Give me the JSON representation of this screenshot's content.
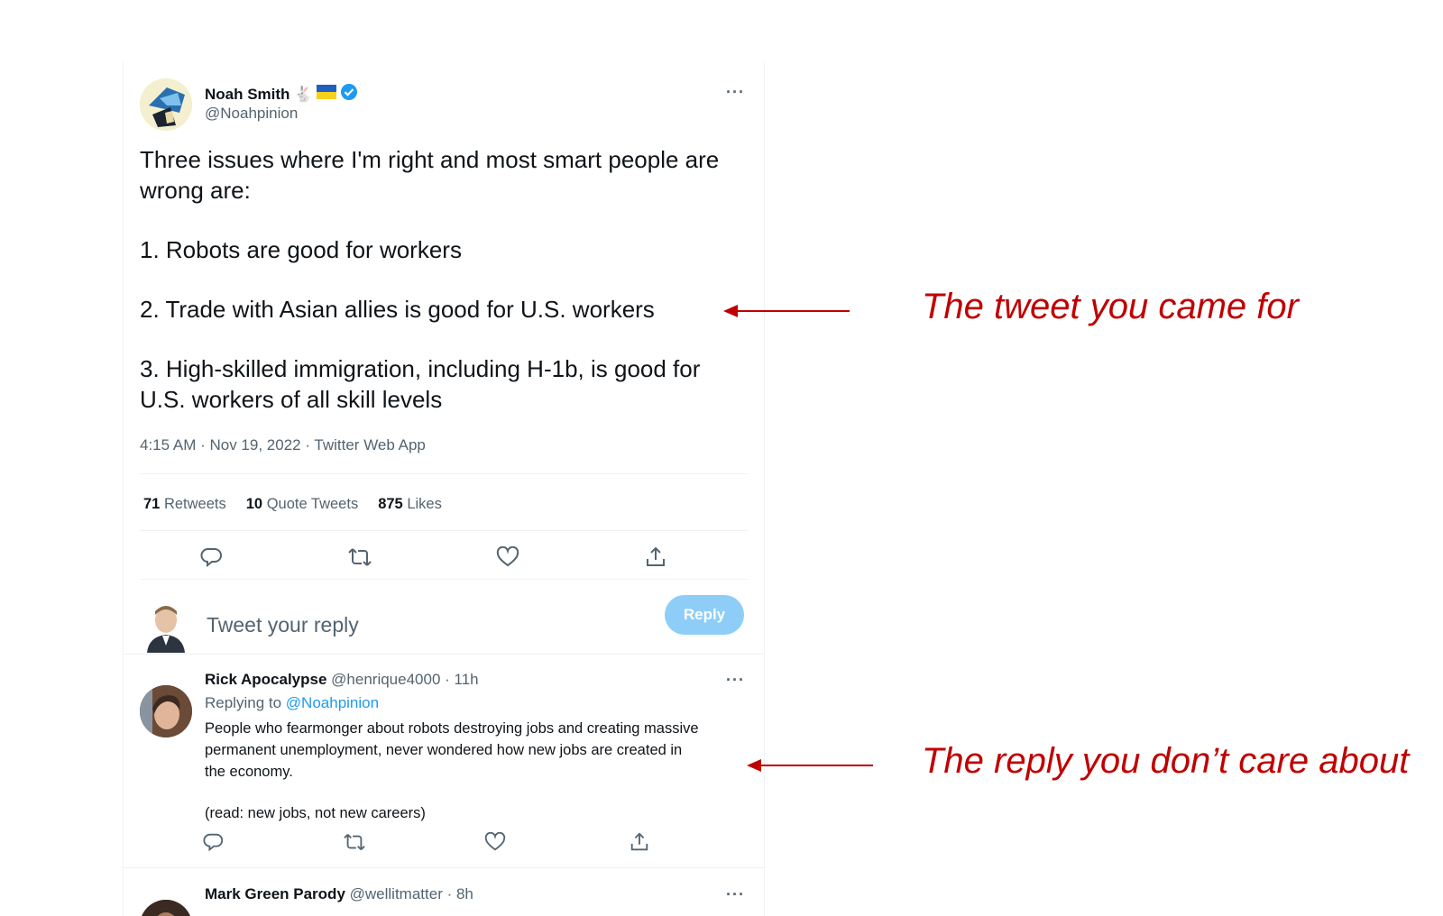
{
  "main_tweet": {
    "author_name": "Noah Smith",
    "author_emoji": "🐇",
    "author_handle": "@Noahpinion",
    "text_lines": [
      "Three issues where I'm right and most smart people are",
      "wrong are:",
      "",
      "1. Robots are good for workers",
      "",
      "2. Trade with Asian allies is good for U.S. workers",
      "",
      "3. High-skilled immigration, including H-1b, is good for",
      "U.S. workers of all skill levels"
    ],
    "meta": "4:15 AM · Nov 19, 2022 · Twitter Web App",
    "stats": {
      "retweets_count": "71",
      "retweets_label": "Retweets",
      "quotes_count": "10",
      "quotes_label": "Quote Tweets",
      "likes_count": "875",
      "likes_label": "Likes"
    },
    "more_label": "···"
  },
  "composer": {
    "placeholder": "Tweet your reply",
    "button_label": "Reply"
  },
  "reply_tweet": {
    "author_name": "Rick Apocalypse",
    "author_handle": "@henrique4000 · 11h",
    "replying_prefix": "Replying to",
    "replying_mention": "@Noahpinion",
    "text_lines": [
      "People who fearmonger about robots destroying jobs and creating massive",
      "permanent unemployment, never wondered how new jobs are created in",
      "the economy.",
      "",
      "(read: new jobs, not new careers)"
    ],
    "more_label": "···"
  },
  "next_tweet": {
    "author_name": "Mark Green Parody",
    "author_handle": "@wellitmatter · 8h",
    "more_label": "···"
  },
  "annotations": {
    "tweet_label": "The tweet you came for",
    "reply_label": "The reply you don’t care about",
    "color": "#c00000"
  },
  "colors": {
    "verified_blue": "#1d9bf0",
    "reply_button": "#8ecdf8",
    "muted_text": "#536471"
  },
  "icons": [
    "reply-icon",
    "retweet-icon",
    "like-icon",
    "share-icon",
    "verified-badge-icon",
    "ukraine-flag-icon",
    "more-icon",
    "arrow-left-icon"
  ]
}
